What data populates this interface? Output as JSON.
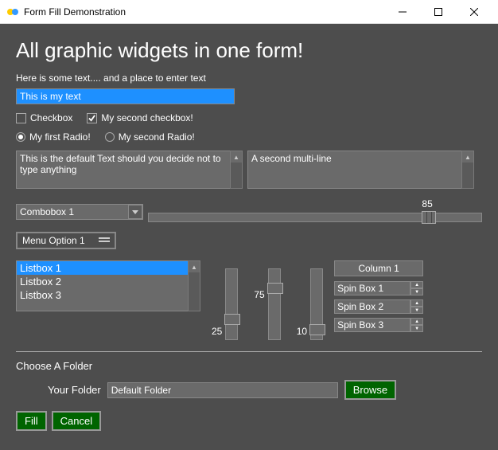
{
  "window": {
    "title": "Form Fill Demonstration"
  },
  "heading": "All graphic widgets in one form!",
  "subheading": "Here is some text.... and a place to enter text",
  "text_input": "This is my text",
  "checkbox1": {
    "label": "Checkbox",
    "checked": false
  },
  "checkbox2": {
    "label": "My second checkbox!",
    "checked": true
  },
  "radio1": {
    "label": "My first Radio!",
    "selected": true
  },
  "radio2": {
    "label": "My second Radio!",
    "selected": false
  },
  "multiline1": "This is the default Text should you decide not to type anything",
  "multiline2": "A second multi-line",
  "combobox": {
    "selected": "Combobox 1"
  },
  "hslider": {
    "value": 85
  },
  "menu_button": "Menu Option 1",
  "listbox": {
    "items": [
      "Listbox 1",
      "Listbox 2",
      "Listbox 3"
    ],
    "selected_index": 0
  },
  "vslider1": {
    "value": 25
  },
  "vslider2": {
    "value": 75
  },
  "vslider3": {
    "value": 10
  },
  "spin_column": {
    "header": "Column 1",
    "items": [
      "Spin Box 1",
      "Spin Box 2",
      "Spin Box 3"
    ]
  },
  "folder": {
    "section_label": "Choose A Folder",
    "field_label": "Your Folder",
    "value": "Default Folder",
    "browse": "Browse"
  },
  "buttons": {
    "fill": "Fill",
    "cancel": "Cancel"
  }
}
